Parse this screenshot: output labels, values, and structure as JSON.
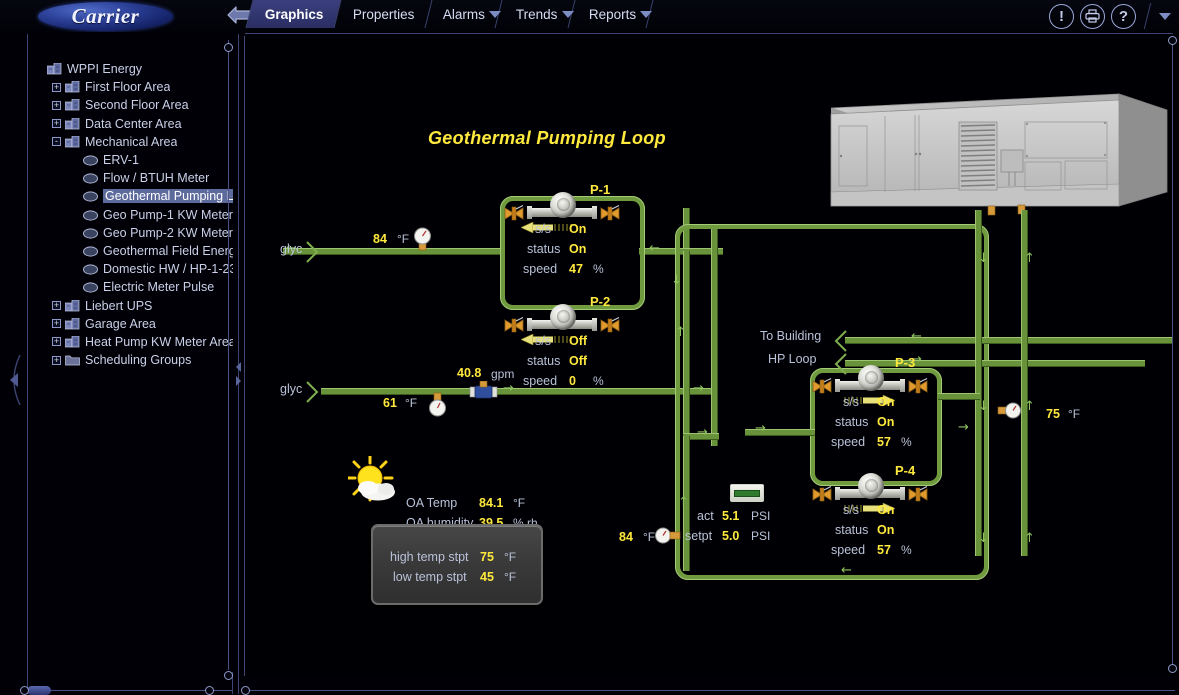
{
  "header": {
    "logo_text": "Carrier",
    "back_icon": "back-arrow-icon",
    "tabs": [
      {
        "label": "Graphics",
        "selected": true,
        "has_caret": false
      },
      {
        "label": "Properties",
        "selected": false,
        "has_caret": false
      },
      {
        "label": "Alarms",
        "selected": false,
        "has_caret": true
      },
      {
        "label": "Trends",
        "selected": false,
        "has_caret": true
      },
      {
        "label": "Reports",
        "selected": false,
        "has_caret": true
      }
    ],
    "buttons": [
      {
        "name": "alert-button",
        "glyph": "!"
      },
      {
        "name": "print-button",
        "glyph": "⎙"
      },
      {
        "name": "help-button",
        "glyph": "?"
      }
    ],
    "overflow_caret": "chevron-down-icon"
  },
  "tree": {
    "items": [
      {
        "label": "WPPI Energy",
        "depth": 0,
        "expander": "",
        "icon": "building-icon",
        "selected": false
      },
      {
        "label": "First Floor Area",
        "depth": 1,
        "expander": "+",
        "icon": "building-icon",
        "selected": false
      },
      {
        "label": "Second Floor Area",
        "depth": 1,
        "expander": "+",
        "icon": "building-icon",
        "selected": false
      },
      {
        "label": "Data Center Area",
        "depth": 1,
        "expander": "+",
        "icon": "building-icon",
        "selected": false
      },
      {
        "label": "Mechanical Area",
        "depth": 1,
        "expander": "-",
        "icon": "building-icon",
        "selected": false
      },
      {
        "label": "ERV-1",
        "depth": 2,
        "expander": "",
        "icon": "device-icon",
        "selected": false
      },
      {
        "label": "Flow / BTUH Meter",
        "depth": 2,
        "expander": "",
        "icon": "device-icon",
        "selected": false
      },
      {
        "label": "Geothermal Pumping Loop",
        "depth": 2,
        "expander": "",
        "icon": "device-icon",
        "selected": true
      },
      {
        "label": "Geo Pump-1 KW Meter",
        "depth": 2,
        "expander": "",
        "icon": "device-icon",
        "selected": false
      },
      {
        "label": "Geo Pump-2 KW Meter",
        "depth": 2,
        "expander": "",
        "icon": "device-icon",
        "selected": false
      },
      {
        "label": "Geothermal Field Energy M",
        "depth": 2,
        "expander": "",
        "icon": "device-icon",
        "selected": false
      },
      {
        "label": "Domestic HW / HP-1-23",
        "depth": 2,
        "expander": "",
        "icon": "device-icon",
        "selected": false
      },
      {
        "label": "Electric Meter Pulse",
        "depth": 2,
        "expander": "",
        "icon": "device-icon",
        "selected": false
      },
      {
        "label": "Liebert UPS",
        "depth": 1,
        "expander": "+",
        "icon": "building-icon",
        "selected": false
      },
      {
        "label": "Garage Area",
        "depth": 1,
        "expander": "+",
        "icon": "building-icon",
        "selected": false
      },
      {
        "label": "Heat Pump KW Meter Area",
        "depth": 1,
        "expander": "+",
        "icon": "building-icon",
        "selected": false
      },
      {
        "label": "Scheduling Groups",
        "depth": 1,
        "expander": "+",
        "icon": "folder-icon",
        "selected": false
      }
    ]
  },
  "graphic": {
    "title": "Geothermal Pumping Loop",
    "supply_label": "glyc",
    "return_label": "glyc",
    "to_building_label": "To Building",
    "hp_loop_label": "HP Loop",
    "temps": {
      "supply_top": {
        "value": "84",
        "unit": "°F"
      },
      "return_bottom": {
        "value": "61",
        "unit": "°F"
      },
      "hp_return": {
        "value": "84",
        "unit": "°F"
      },
      "hp_supply": {
        "value": "75",
        "unit": "°F"
      }
    },
    "flow": {
      "value": "40.8",
      "unit": "gpm"
    },
    "pressure": {
      "act_label": "act",
      "act_value": "5.1",
      "act_unit": "PSI",
      "setpt_label": "setpt",
      "setpt_value": "5.0",
      "setpt_unit": "PSI"
    },
    "pumps": [
      {
        "name": "P-1",
        "ss_label": "s/s",
        "ss_value": "On",
        "status_label": "status",
        "status_value": "On",
        "speed_label": "speed",
        "speed_value": "47",
        "speed_unit": "%",
        "flow_dir": "left"
      },
      {
        "name": "P-2",
        "ss_label": "s/s",
        "ss_value": "Off",
        "status_label": "status",
        "status_value": "Off",
        "speed_label": "speed",
        "speed_value": "0",
        "speed_unit": "%",
        "flow_dir": "left"
      },
      {
        "name": "P-3",
        "ss_label": "s/s",
        "ss_value": "On",
        "status_label": "status",
        "status_value": "On",
        "speed_label": "speed",
        "speed_value": "57",
        "speed_unit": "%",
        "flow_dir": "right"
      },
      {
        "name": "P-4",
        "ss_label": "s/s",
        "ss_value": "On",
        "status_label": "status",
        "status_value": "On",
        "speed_label": "speed",
        "speed_value": "57",
        "speed_unit": "%",
        "flow_dir": "right"
      }
    ],
    "weather": {
      "oa_temp_label": "OA Temp",
      "oa_temp_value": "84.1",
      "oa_temp_unit": "°F",
      "oa_hum_label": "OA humidity",
      "oa_hum_value": "39.5",
      "oa_hum_unit": "% rh",
      "icon": "sun-cloud-icon"
    },
    "setpoints": {
      "high_label": "high temp stpt",
      "high_value": "75",
      "high_unit": "°F",
      "low_label": "low temp stpt",
      "low_value": "45",
      "low_unit": "°F"
    },
    "equipment_icon": "mechanical-cabinet-icon"
  },
  "colors": {
    "pipe": "#69933a",
    "value_yellow": "#ffe93d",
    "label_gray": "#b9c2d8",
    "accent_blue": "#3b3f7d"
  }
}
